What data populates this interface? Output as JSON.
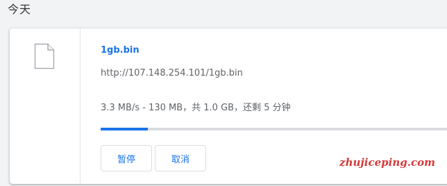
{
  "section": {
    "title": "今天"
  },
  "download": {
    "file_name": "1gb.bin",
    "url": "http://107.148.254.101/1gb.bin",
    "status": "3.3 MB/s - 130 MB，共 1.0 GB，还剩 5 分钟",
    "progress": 0.13,
    "buttons": {
      "pause": "暂停",
      "cancel": "取消"
    }
  },
  "colors": {
    "accent": "#1a73e8",
    "track": "#dadce0",
    "watermark": "#d43a3a"
  },
  "icons": {
    "file": "file-icon"
  },
  "watermark": {
    "text": "zhujiceping.com"
  }
}
